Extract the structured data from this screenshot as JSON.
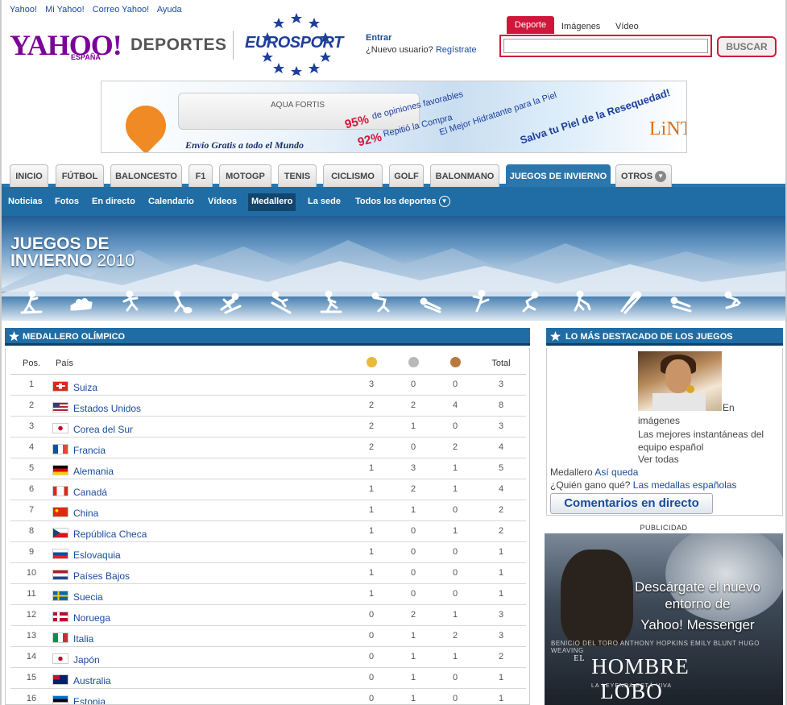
{
  "top_links": [
    "Yahoo!",
    "Mi Yahoo!",
    "Correo Yahoo!",
    "Ayuda"
  ],
  "logo": {
    "yahoo": "YAHOO!",
    "espana": "ESPAÑA",
    "deportes": "DEPORTES",
    "eurosport": "EUROSPORT"
  },
  "account": {
    "entrar": "Entrar",
    "nuevo": "¿Nuevo usuario?",
    "registrate": "Regístrate"
  },
  "search": {
    "tabs": [
      "Deporte",
      "Imágenes",
      "Vídeo"
    ],
    "value": "",
    "button": "BUSCAR"
  },
  "ad": {
    "brand": "AQUA FORTIS",
    "envio": "Envío Gratis a todo el Mundo",
    "pct1": "95%",
    "txt1": "de opiniones favorables",
    "pct2": "92%",
    "txt2": "Repitió la Compra",
    "txt3": "El Mejor Hidratante para la Piel",
    "txt4": "Salva tu Piel de la Resequedad!",
    "logo": "LiNT"
  },
  "nav": {
    "tabs": [
      "INICIO",
      "FÚTBOL",
      "BALONCESTO",
      "F1",
      "MOTOGP",
      "TENIS",
      "CICLISMO",
      "GOLF",
      "BALONMANO",
      "JUEGOS DE INVIERNO",
      "OTROS"
    ],
    "active": "JUEGOS DE INVIERNO"
  },
  "subnav": {
    "items": [
      "Noticias",
      "Fotos",
      "En directo",
      "Calendario",
      "Vídeos",
      "Medallero",
      "La sede",
      "Todos los deportes"
    ],
    "active": "Medallero"
  },
  "banner": {
    "title_line1": "JUEGOS DE",
    "title_line2": "INVIERNO",
    "year": "2010"
  },
  "medallero": {
    "title": "MEDALLERO OLÍMPICO",
    "headers": {
      "pos": "Pos.",
      "pais": "País",
      "total": "Total"
    },
    "medal_colors": {
      "gold": "#e9b93a",
      "silver": "#b8b8b8",
      "bronze": "#b87a3e"
    },
    "rows": [
      {
        "pos": "1",
        "pais": "Suiza",
        "flag": "ch",
        "oro": "3",
        "plata": "0",
        "bronce": "0",
        "total": "3"
      },
      {
        "pos": "2",
        "pais": "Estados Unidos",
        "flag": "us",
        "oro": "2",
        "plata": "2",
        "bronce": "4",
        "total": "8"
      },
      {
        "pos": "3",
        "pais": "Corea del Sur",
        "flag": "kr",
        "oro": "2",
        "plata": "1",
        "bronce": "0",
        "total": "3"
      },
      {
        "pos": "4",
        "pais": "Francia",
        "flag": "fr",
        "oro": "2",
        "plata": "0",
        "bronce": "2",
        "total": "4"
      },
      {
        "pos": "5",
        "pais": "Alemania",
        "flag": "de",
        "oro": "1",
        "plata": "3",
        "bronce": "1",
        "total": "5"
      },
      {
        "pos": "6",
        "pais": "Canadá",
        "flag": "ca",
        "oro": "1",
        "plata": "2",
        "bronce": "1",
        "total": "4"
      },
      {
        "pos": "7",
        "pais": "China",
        "flag": "cn",
        "oro": "1",
        "plata": "1",
        "bronce": "0",
        "total": "2"
      },
      {
        "pos": "8",
        "pais": "República Checa",
        "flag": "cz",
        "oro": "1",
        "plata": "0",
        "bronce": "1",
        "total": "2"
      },
      {
        "pos": "9",
        "pais": "Eslovaquia",
        "flag": "sk",
        "oro": "1",
        "plata": "0",
        "bronce": "0",
        "total": "1"
      },
      {
        "pos": "10",
        "pais": "Países Bajos",
        "flag": "nl",
        "oro": "1",
        "plata": "0",
        "bronce": "0",
        "total": "1"
      },
      {
        "pos": "11",
        "pais": "Suecia",
        "flag": "se",
        "oro": "1",
        "plata": "0",
        "bronce": "0",
        "total": "1"
      },
      {
        "pos": "12",
        "pais": "Noruega",
        "flag": "no",
        "oro": "0",
        "plata": "2",
        "bronce": "1",
        "total": "3"
      },
      {
        "pos": "13",
        "pais": "Italia",
        "flag": "it",
        "oro": "0",
        "plata": "1",
        "bronce": "2",
        "total": "3"
      },
      {
        "pos": "14",
        "pais": "Japón",
        "flag": "jp",
        "oro": "0",
        "plata": "1",
        "bronce": "1",
        "total": "2"
      },
      {
        "pos": "15",
        "pais": "Australia",
        "flag": "au",
        "oro": "0",
        "plata": "1",
        "bronce": "0",
        "total": "1"
      },
      {
        "pos": "16",
        "pais": "Estonia",
        "flag": "ee",
        "oro": "0",
        "plata": "1",
        "bronce": "0",
        "total": "1"
      }
    ]
  },
  "destacado": {
    "title": "LO MÁS DESTACADO DE LOS JUEGOS",
    "en": "En",
    "imagenes": "imágenes",
    "desc": "Las mejores instantáneas del equipo español",
    "ver_todas": "Ver todas",
    "medallero_label": "Medallero",
    "medallero_link": "Así queda",
    "quien_label": "¿Quién gano qué?",
    "quien_link": "Las medallas españolas",
    "comentarios": "Comentarios en directo"
  },
  "publicidad": {
    "label": "PUBLICIDAD",
    "msg1": "Descárgate el nuevo",
    "msg2": "entorno de",
    "msg3": "Yahoo! Messenger",
    "cast": "BENICIO DEL TORO   ANTHONY HOPKINS   EMILY BLUNT   HUGO WEAVING",
    "movie_small": "EL",
    "movie": "HOMBRE LOBO",
    "tagline": "LA LEYENDA ESTÁ VIVA"
  }
}
